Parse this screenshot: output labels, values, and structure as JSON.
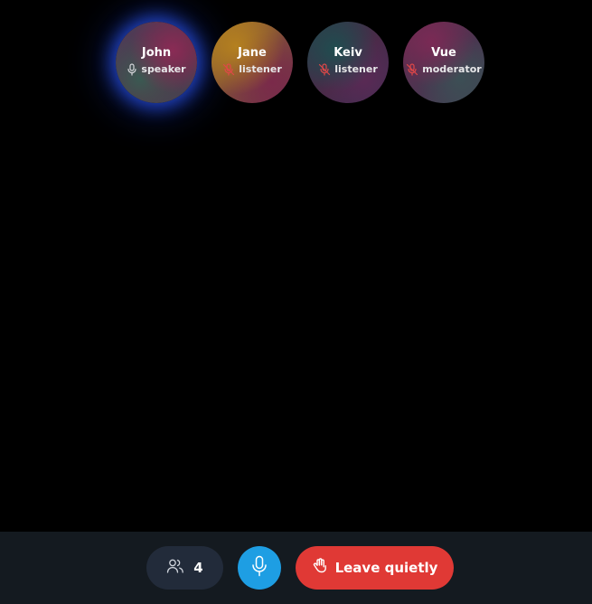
{
  "participants": [
    {
      "name": "John",
      "role": "speaker",
      "muted": false,
      "speaking": true
    },
    {
      "name": "Jane",
      "role": "listener",
      "muted": true,
      "speaking": false
    },
    {
      "name": "Keiv",
      "role": "listener",
      "muted": true,
      "speaking": false
    },
    {
      "name": "Vue",
      "role": "moderator",
      "muted": true,
      "speaking": false
    }
  ],
  "controls": {
    "participant_count": "4",
    "participants_icon": "users-icon",
    "mic_icon": "microphone-icon",
    "leave_icon": "hand-wave-icon",
    "leave_label": "Leave quietly"
  },
  "colors": {
    "background": "#000000",
    "bottom_bar": "#141a20",
    "count_button": "#222b3a",
    "mic_button": "#1e9ee3",
    "leave_button": "#e03935",
    "speaking_glow": "#2850e6",
    "muted_icon": "#e04848"
  }
}
